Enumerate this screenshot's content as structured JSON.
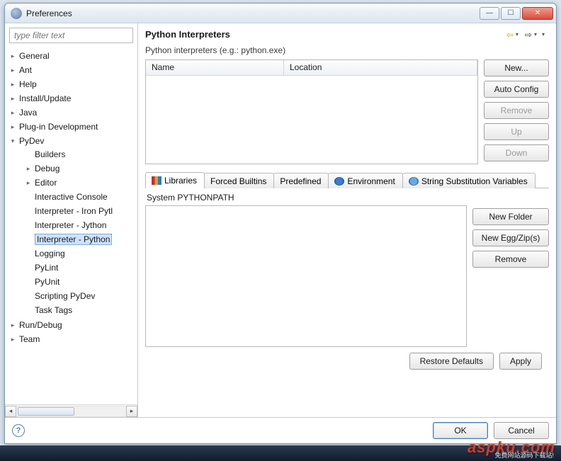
{
  "window": {
    "title": "Preferences"
  },
  "sidebar": {
    "filter_placeholder": "type filter text",
    "items": [
      {
        "label": "General",
        "expandable": true,
        "children": []
      },
      {
        "label": "Ant",
        "expandable": true,
        "children": []
      },
      {
        "label": "Help",
        "expandable": true,
        "children": []
      },
      {
        "label": "Install/Update",
        "expandable": true,
        "children": []
      },
      {
        "label": "Java",
        "expandable": true,
        "children": []
      },
      {
        "label": "Plug-in Development",
        "expandable": true,
        "children": []
      },
      {
        "label": "PyDev",
        "expandable": true,
        "expanded": true,
        "children": [
          {
            "label": "Builders"
          },
          {
            "label": "Debug",
            "expandable": true
          },
          {
            "label": "Editor",
            "expandable": true
          },
          {
            "label": "Interactive Console"
          },
          {
            "label": "Interpreter - Iron Pytl"
          },
          {
            "label": "Interpreter - Jython"
          },
          {
            "label": "Interpreter - Python",
            "selected": true
          },
          {
            "label": "Logging"
          },
          {
            "label": "PyLint"
          },
          {
            "label": "PyUnit"
          },
          {
            "label": "Scripting PyDev"
          },
          {
            "label": "Task Tags"
          }
        ]
      },
      {
        "label": "Run/Debug",
        "expandable": true,
        "children": []
      },
      {
        "label": "Team",
        "expandable": true,
        "children": []
      }
    ]
  },
  "main": {
    "title": "Python Interpreters",
    "desc": "Python interpreters (e.g.: python.exe)",
    "columns": {
      "name": "Name",
      "location": "Location"
    },
    "buttons": {
      "new": "New...",
      "auto": "Auto Config",
      "remove": "Remove",
      "up": "Up",
      "down": "Down"
    },
    "tabs": [
      {
        "label": "Libraries",
        "icon": "lib",
        "active": true
      },
      {
        "label": "Forced Builtins"
      },
      {
        "label": "Predefined"
      },
      {
        "label": "Environment",
        "icon": "env"
      },
      {
        "label": "String Substitution Variables",
        "icon": "str"
      }
    ],
    "pythonpath_label": "System PYTHONPATH",
    "pp_buttons": {
      "newfolder": "New Folder",
      "newegg": "New Egg/Zip(s)",
      "remove": "Remove"
    },
    "footer": {
      "restore": "Restore Defaults",
      "apply": "Apply",
      "ok": "OK",
      "cancel": "Cancel"
    }
  },
  "watermark": {
    "text": "aspku.com",
    "sub": "免费网站源码下载站!"
  }
}
